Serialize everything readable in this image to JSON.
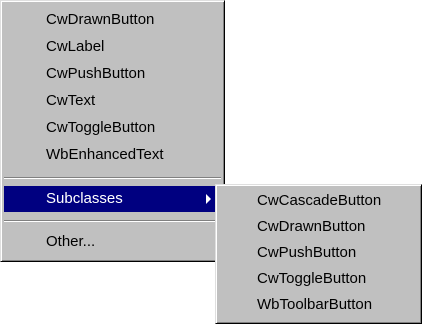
{
  "main_menu": {
    "items": [
      {
        "label": "CwDrawnButton"
      },
      {
        "label": "CwLabel"
      },
      {
        "label": "CwPushButton"
      },
      {
        "label": "CwText"
      },
      {
        "label": "CwToggleButton"
      },
      {
        "label": "WbEnhancedText"
      }
    ],
    "subclasses_label": "Subclasses",
    "other_label": "Other..."
  },
  "sub_menu": {
    "items": [
      {
        "label": "CwCascadeButton"
      },
      {
        "label": "CwDrawnButton"
      },
      {
        "label": "CwPushButton"
      },
      {
        "label": "CwToggleButton"
      },
      {
        "label": "WbToolbarButton"
      }
    ]
  },
  "colors": {
    "menu_bg": "#c0c0c0",
    "highlight_bg": "#000080",
    "highlight_text": "#ffffff"
  },
  "icons": {
    "submenu_arrow": "chevron-right-icon"
  }
}
